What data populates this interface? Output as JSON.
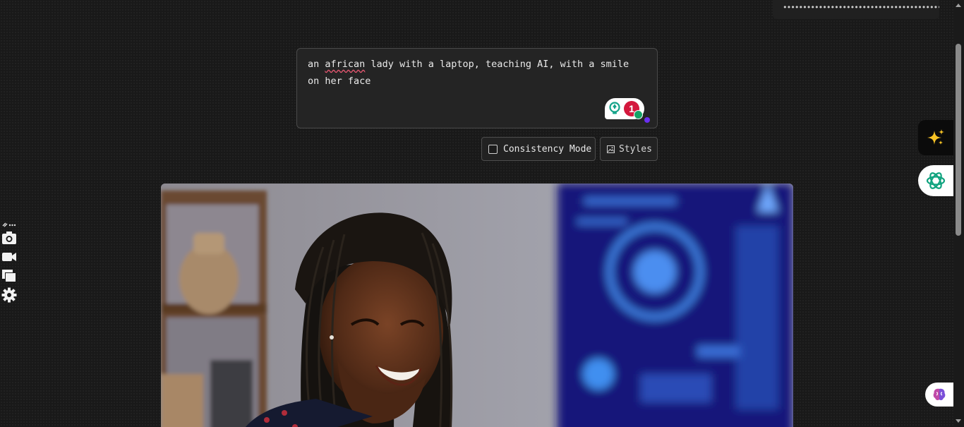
{
  "header": {
    "masked_value": "••••••••••••••••••••••••••••••••••••••••"
  },
  "prompt": {
    "text_before": "an ",
    "misspelled_word": "african",
    "text_after": " lady with a laptop, teaching AI, with a smile on her face"
  },
  "grammar_widget": {
    "issue_count": "1"
  },
  "options": {
    "consistency_label": "Consistency Mode",
    "styles_label": "Styles"
  },
  "left_toolbar": {
    "icons": [
      "link-more-icon",
      "camera-icon",
      "video-icon",
      "gallery-icon",
      "settings-icon"
    ]
  },
  "side_buttons": {
    "icons": [
      "sparkle-icon",
      "chatgpt-icon",
      "brain-icon"
    ]
  },
  "colors": {
    "background": "#191919",
    "spell_underline": "#e0556e",
    "badge_red": "#d4183d",
    "badge_green": "#15a366",
    "accent_purple": "#6a2ff0",
    "chatgpt_green": "#10a37f"
  }
}
